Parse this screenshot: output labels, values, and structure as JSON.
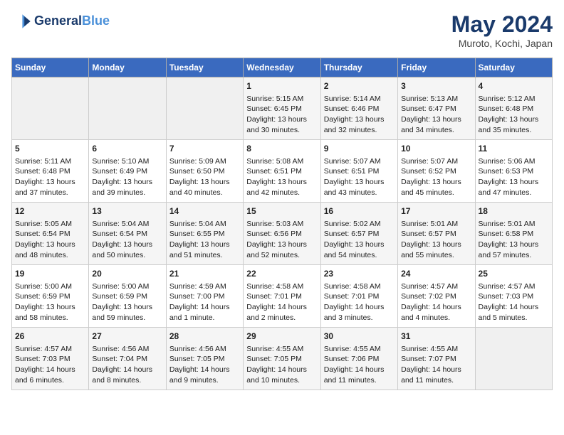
{
  "logo": {
    "line1": "General",
    "line2": "Blue"
  },
  "title": "May 2024",
  "location": "Muroto, Kochi, Japan",
  "days_of_week": [
    "Sunday",
    "Monday",
    "Tuesday",
    "Wednesday",
    "Thursday",
    "Friday",
    "Saturday"
  ],
  "weeks": [
    [
      {
        "day": "",
        "content": ""
      },
      {
        "day": "",
        "content": ""
      },
      {
        "day": "",
        "content": ""
      },
      {
        "day": "1",
        "content": "Sunrise: 5:15 AM\nSunset: 6:45 PM\nDaylight: 13 hours\nand 30 minutes."
      },
      {
        "day": "2",
        "content": "Sunrise: 5:14 AM\nSunset: 6:46 PM\nDaylight: 13 hours\nand 32 minutes."
      },
      {
        "day": "3",
        "content": "Sunrise: 5:13 AM\nSunset: 6:47 PM\nDaylight: 13 hours\nand 34 minutes."
      },
      {
        "day": "4",
        "content": "Sunrise: 5:12 AM\nSunset: 6:48 PM\nDaylight: 13 hours\nand 35 minutes."
      }
    ],
    [
      {
        "day": "5",
        "content": "Sunrise: 5:11 AM\nSunset: 6:48 PM\nDaylight: 13 hours\nand 37 minutes."
      },
      {
        "day": "6",
        "content": "Sunrise: 5:10 AM\nSunset: 6:49 PM\nDaylight: 13 hours\nand 39 minutes."
      },
      {
        "day": "7",
        "content": "Sunrise: 5:09 AM\nSunset: 6:50 PM\nDaylight: 13 hours\nand 40 minutes."
      },
      {
        "day": "8",
        "content": "Sunrise: 5:08 AM\nSunset: 6:51 PM\nDaylight: 13 hours\nand 42 minutes."
      },
      {
        "day": "9",
        "content": "Sunrise: 5:07 AM\nSunset: 6:51 PM\nDaylight: 13 hours\nand 43 minutes."
      },
      {
        "day": "10",
        "content": "Sunrise: 5:07 AM\nSunset: 6:52 PM\nDaylight: 13 hours\nand 45 minutes."
      },
      {
        "day": "11",
        "content": "Sunrise: 5:06 AM\nSunset: 6:53 PM\nDaylight: 13 hours\nand 47 minutes."
      }
    ],
    [
      {
        "day": "12",
        "content": "Sunrise: 5:05 AM\nSunset: 6:54 PM\nDaylight: 13 hours\nand 48 minutes."
      },
      {
        "day": "13",
        "content": "Sunrise: 5:04 AM\nSunset: 6:54 PM\nDaylight: 13 hours\nand 50 minutes."
      },
      {
        "day": "14",
        "content": "Sunrise: 5:04 AM\nSunset: 6:55 PM\nDaylight: 13 hours\nand 51 minutes."
      },
      {
        "day": "15",
        "content": "Sunrise: 5:03 AM\nSunset: 6:56 PM\nDaylight: 13 hours\nand 52 minutes."
      },
      {
        "day": "16",
        "content": "Sunrise: 5:02 AM\nSunset: 6:57 PM\nDaylight: 13 hours\nand 54 minutes."
      },
      {
        "day": "17",
        "content": "Sunrise: 5:01 AM\nSunset: 6:57 PM\nDaylight: 13 hours\nand 55 minutes."
      },
      {
        "day": "18",
        "content": "Sunrise: 5:01 AM\nSunset: 6:58 PM\nDaylight: 13 hours\nand 57 minutes."
      }
    ],
    [
      {
        "day": "19",
        "content": "Sunrise: 5:00 AM\nSunset: 6:59 PM\nDaylight: 13 hours\nand 58 minutes."
      },
      {
        "day": "20",
        "content": "Sunrise: 5:00 AM\nSunset: 6:59 PM\nDaylight: 13 hours\nand 59 minutes."
      },
      {
        "day": "21",
        "content": "Sunrise: 4:59 AM\nSunset: 7:00 PM\nDaylight: 14 hours\nand 1 minute."
      },
      {
        "day": "22",
        "content": "Sunrise: 4:58 AM\nSunset: 7:01 PM\nDaylight: 14 hours\nand 2 minutes."
      },
      {
        "day": "23",
        "content": "Sunrise: 4:58 AM\nSunset: 7:01 PM\nDaylight: 14 hours\nand 3 minutes."
      },
      {
        "day": "24",
        "content": "Sunrise: 4:57 AM\nSunset: 7:02 PM\nDaylight: 14 hours\nand 4 minutes."
      },
      {
        "day": "25",
        "content": "Sunrise: 4:57 AM\nSunset: 7:03 PM\nDaylight: 14 hours\nand 5 minutes."
      }
    ],
    [
      {
        "day": "26",
        "content": "Sunrise: 4:57 AM\nSunset: 7:03 PM\nDaylight: 14 hours\nand 6 minutes."
      },
      {
        "day": "27",
        "content": "Sunrise: 4:56 AM\nSunset: 7:04 PM\nDaylight: 14 hours\nand 8 minutes."
      },
      {
        "day": "28",
        "content": "Sunrise: 4:56 AM\nSunset: 7:05 PM\nDaylight: 14 hours\nand 9 minutes."
      },
      {
        "day": "29",
        "content": "Sunrise: 4:55 AM\nSunset: 7:05 PM\nDaylight: 14 hours\nand 10 minutes."
      },
      {
        "day": "30",
        "content": "Sunrise: 4:55 AM\nSunset: 7:06 PM\nDaylight: 14 hours\nand 11 minutes."
      },
      {
        "day": "31",
        "content": "Sunrise: 4:55 AM\nSunset: 7:07 PM\nDaylight: 14 hours\nand 11 minutes."
      },
      {
        "day": "",
        "content": ""
      }
    ]
  ]
}
